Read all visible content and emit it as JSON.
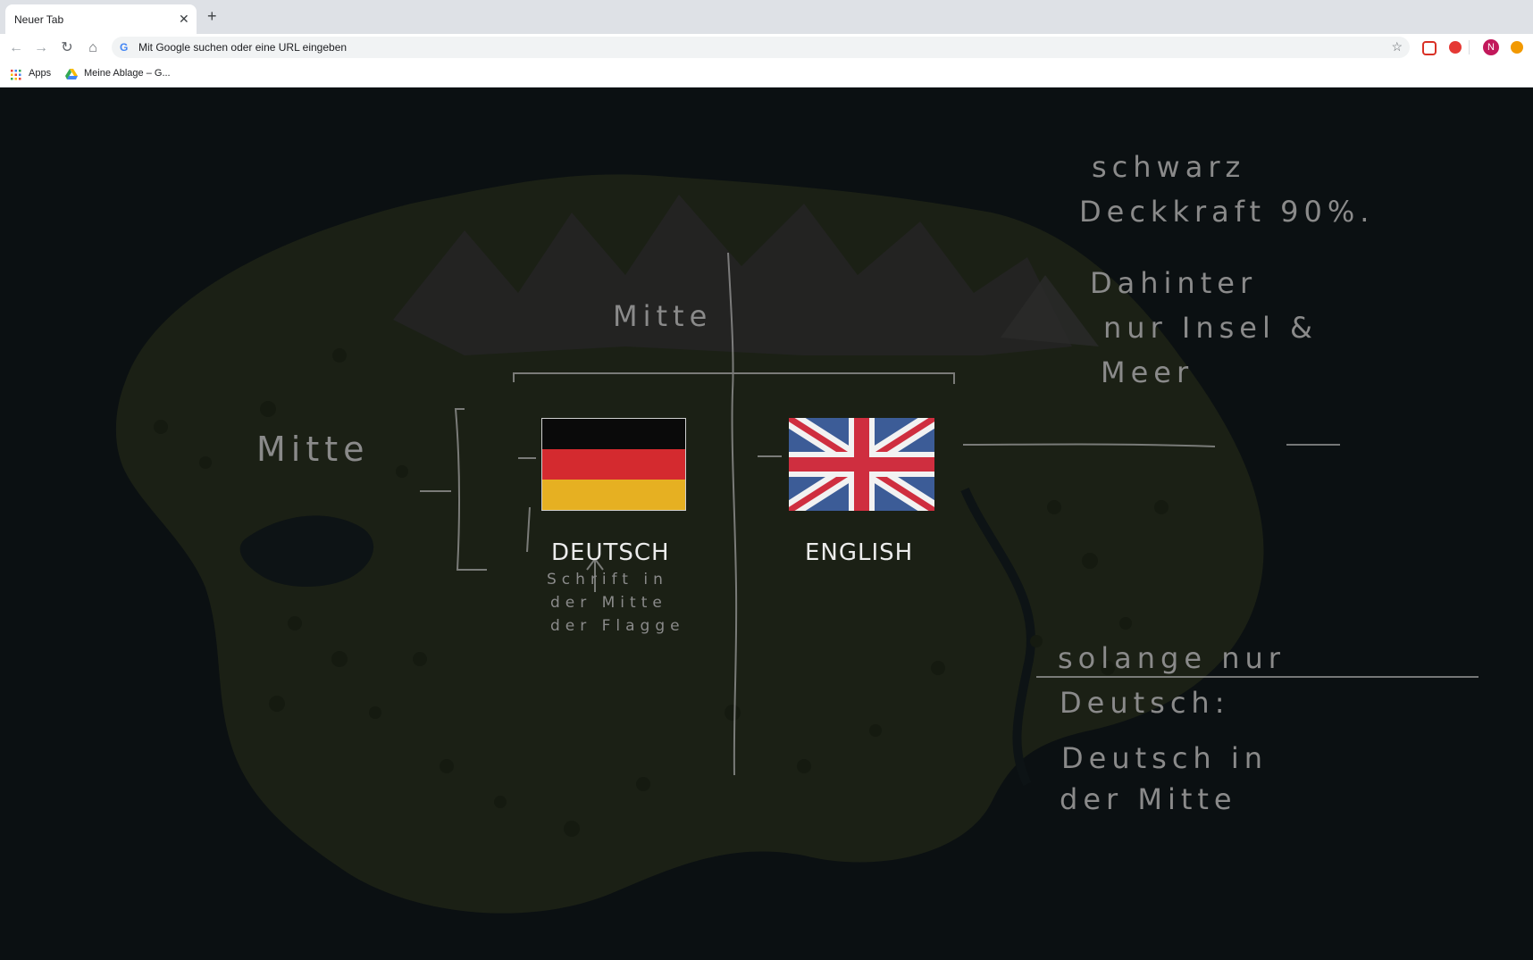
{
  "browser": {
    "tab_title": "Neuer Tab",
    "omnibox_placeholder": "Mit Google suchen oder eine URL eingeben",
    "bookmarks": [
      "Apps",
      "Meine Ablage – G..."
    ],
    "profile_initial": "N"
  },
  "page": {
    "languages": [
      {
        "label": "DEUTSCH",
        "flag": "german-flag"
      },
      {
        "label": "ENGLISH",
        "flag": "union-jack-flag"
      }
    ],
    "sketch_notes": {
      "mitte_top": "Mitte",
      "mitte_left": "Mitte",
      "schrift_line1": "Schrift in",
      "schrift_line2": "der Mitte",
      "schrift_line3": "der Flagge",
      "right_line1": "schwarz",
      "right_line2": "Deckkraft 90%.",
      "right_line3": "Dahinter",
      "right_line4": "nur Insel &",
      "right_line5": "Meer",
      "right_line6": "solange nur",
      "right_line7": "Deutsch:",
      "right_line8": "Deutsch in",
      "right_line9": "der Mitte"
    },
    "colors": {
      "overlay": "#0b1012",
      "island": "#1c2115",
      "sketch": "#8a8a8a"
    }
  }
}
